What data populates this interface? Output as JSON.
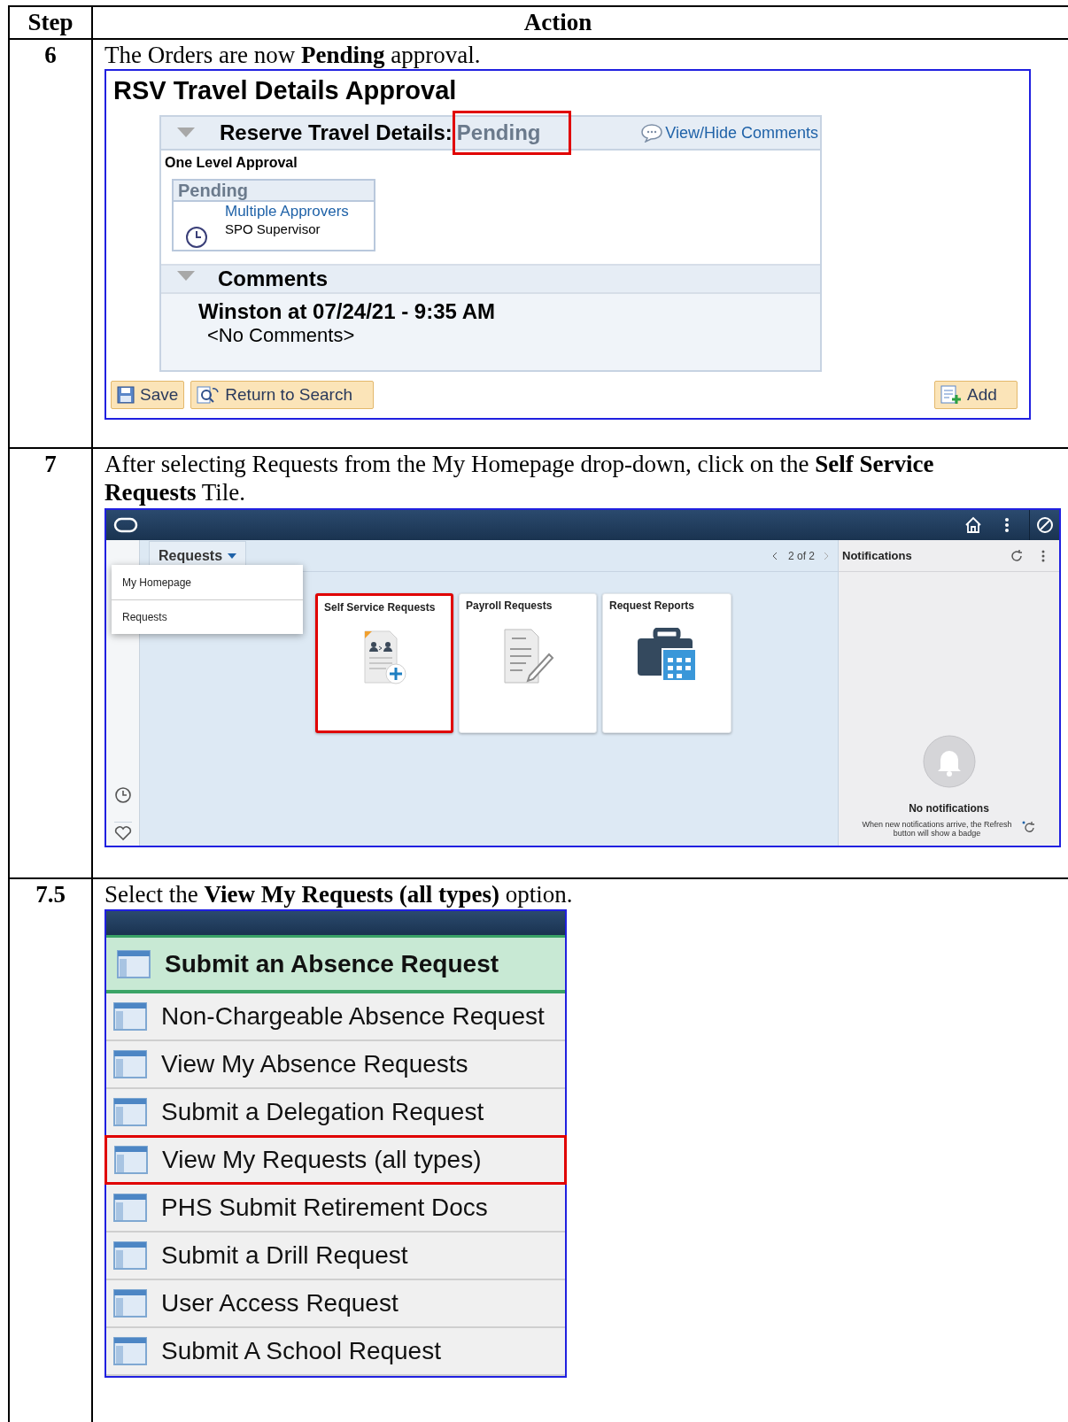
{
  "table": {
    "columns": [
      "Step",
      "Action"
    ]
  },
  "steps": [
    {
      "step": "6",
      "kind": "approval",
      "instruction": "The Orders are now **Pending** approval.",
      "approval": {
        "title": "RSV Travel Details Approval",
        "section": {
          "label": "Reserve Travel Details:",
          "status": "Pending",
          "highlighted": true,
          "expanded": true
        },
        "link": "View/Hide Comments",
        "subtitle": "One Level Approval",
        "approver_box": {
          "status": "Pending",
          "approver": "Multiple Approvers",
          "role": "SPO Supervisor"
        },
        "comments": {
          "title": "Comments",
          "expanded": true,
          "author": "Winston at 07/24/21 - 9:35 AM",
          "text": "<No Comments>"
        },
        "buttons": [
          {
            "label": "Save",
            "kind": "save"
          },
          {
            "label": "Return to Search",
            "kind": "search"
          },
          {
            "label": "Add",
            "kind": "add"
          }
        ]
      }
    },
    {
      "step": "7",
      "kind": "homepage",
      "instruction": "After selecting Requests from the My Homepage drop-down, click on the **Self Service Requests** Tile.",
      "homepage": {
        "dropdown": {
          "label": "Requests",
          "expanded": true,
          "menu": [
            {
              "label": "My Homepage",
              "selected": false
            },
            {
              "label": "Requests",
              "selected": false
            }
          ]
        },
        "pager": "2 of 2",
        "tiles": [
          {
            "title": "Self Service Requests",
            "kind": "self-service",
            "highlighted": true
          },
          {
            "title": "Payroll Requests",
            "kind": "payroll",
            "highlighted": false
          },
          {
            "title": "Request Reports",
            "kind": "reports",
            "highlighted": false
          }
        ],
        "notifications": {
          "title": "Notifications",
          "empty_title": "No notifications",
          "empty_text": "When new notifications arrive, the Refresh button will show a badge"
        }
      }
    },
    {
      "step": "7.5",
      "kind": "menu",
      "instruction": "Select the **View My Requests (all types)** option.",
      "menu": [
        {
          "label": "Submit an Absence Request",
          "selected": true,
          "highlighted": false
        },
        {
          "label": "Non-Chargeable Absence Request",
          "selected": false,
          "highlighted": false
        },
        {
          "label": "View My Absence Requests",
          "selected": false,
          "highlighted": false
        },
        {
          "label": "Submit a Delegation Request",
          "selected": false,
          "highlighted": false
        },
        {
          "label": "View My Requests (all types)",
          "selected": false,
          "highlighted": true
        },
        {
          "label": "PHS Submit Retirement Docs",
          "selected": false,
          "highlighted": false
        },
        {
          "label": "Submit a Drill Request",
          "selected": false,
          "highlighted": false
        },
        {
          "label": "User Access Request",
          "selected": false,
          "highlighted": false
        },
        {
          "label": "Submit A School Request",
          "selected": false,
          "highlighted": false
        }
      ]
    }
  ]
}
